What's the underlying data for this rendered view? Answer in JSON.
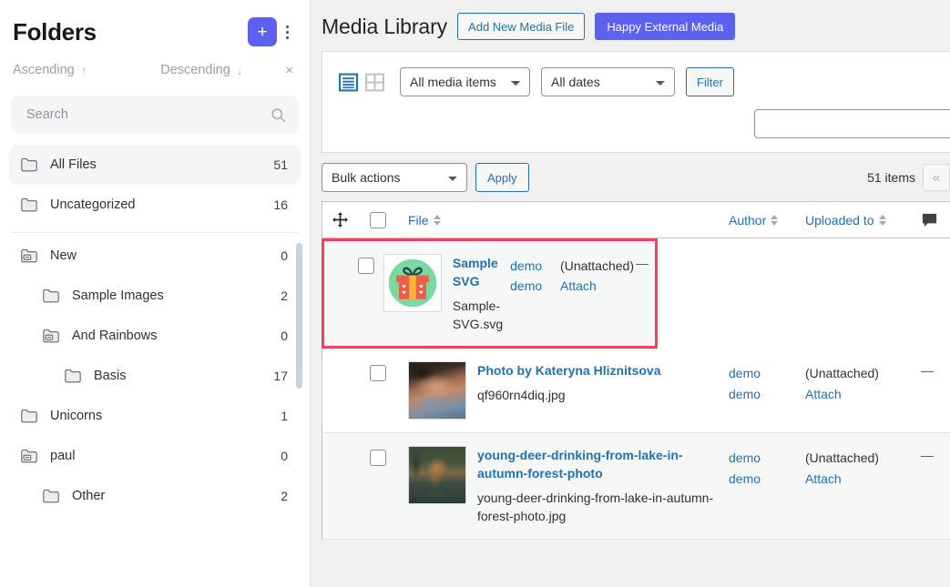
{
  "sidebar": {
    "title": "Folders",
    "add_label": "+",
    "menu_icon": "kebab-menu-icon",
    "sort": {
      "ascending_label": "Ascending",
      "ascending_arrow": "↑",
      "descending_label": "Descending",
      "descending_arrow": "↓",
      "clear_label": "×"
    },
    "search": {
      "placeholder": "Search",
      "value": ""
    },
    "top_folders": [
      {
        "name": "All Files",
        "count": "51",
        "icon": "folder-icon",
        "active": true
      },
      {
        "name": "Uncategorized",
        "count": "16",
        "icon": "folder-icon",
        "active": false
      }
    ],
    "tree": [
      {
        "name": "New",
        "count": "0",
        "icon": "folder-open-icon",
        "indent": 0
      },
      {
        "name": "Sample Images",
        "count": "2",
        "icon": "folder-icon",
        "indent": 1
      },
      {
        "name": "And Rainbows",
        "count": "0",
        "icon": "folder-open-icon",
        "indent": 1
      },
      {
        "name": "Basis",
        "count": "17",
        "icon": "folder-icon",
        "indent": 2
      },
      {
        "name": "Unicorns",
        "count": "1",
        "icon": "folder-icon",
        "indent": 0
      },
      {
        "name": "paul",
        "count": "0",
        "icon": "folder-open-icon",
        "indent": 0
      },
      {
        "name": "Other",
        "count": "2",
        "icon": "folder-icon",
        "indent": 1
      }
    ]
  },
  "header": {
    "title": "Media Library",
    "add_new_label": "Add New Media File",
    "external_media_label": "Happy External Media"
  },
  "toolbar": {
    "list_view_icon": "list-view-icon",
    "grid_view_icon": "grid-view-icon",
    "media_filter": {
      "selected": "All media items"
    },
    "date_filter": {
      "selected": "All dates"
    },
    "filter_label": "Filter",
    "search_value": "",
    "search_placeholder": ""
  },
  "bulk": {
    "action_selected": "Bulk actions",
    "apply_label": "Apply",
    "items_count": "51 items",
    "prev_page_label": "«"
  },
  "table": {
    "columns": {
      "move_icon": "move-handle-icon",
      "select_all": "select-all-checkbox",
      "file": "File",
      "author": "Author",
      "uploaded_to": "Uploaded to",
      "comment_icon": "comment-bubble-icon"
    },
    "rows": [
      {
        "title": "Sample SVG",
        "filename": "Sample-SVG.svg",
        "thumb": "gift-box-thumbnail",
        "author": "demo",
        "author_2": "demo",
        "uploaded_to": "(Unattached)",
        "attach_label": "Attach",
        "comments": "—",
        "highlighted": true,
        "shaded": true
      },
      {
        "title": "Photo by Kateryna Hliznitsova",
        "filename": "qf960rn4diq.jpg",
        "thumb": "person-photo-thumbnail",
        "author": "demo",
        "author_2": "demo",
        "uploaded_to": "(Unattached)",
        "attach_label": "Attach",
        "comments": "—",
        "highlighted": false,
        "shaded": false
      },
      {
        "title": "young-deer-drinking-from-lake-in-autumn-forest-photo",
        "filename": "young-deer-drinking-from-lake-in-autumn-forest-photo.jpg",
        "thumb": "deer-photo-thumbnail",
        "author": "demo",
        "author_2": "demo",
        "uploaded_to": "(Unattached)",
        "attach_label": "Attach",
        "comments": "—",
        "highlighted": false,
        "shaded": true
      }
    ]
  },
  "colors": {
    "brand_purple": "#5c62ee",
    "wp_blue": "#2271b1",
    "highlight_pink": "#f43f5e",
    "row_shade": "#f6f7f7",
    "page_bg": "#f0f0f1"
  }
}
